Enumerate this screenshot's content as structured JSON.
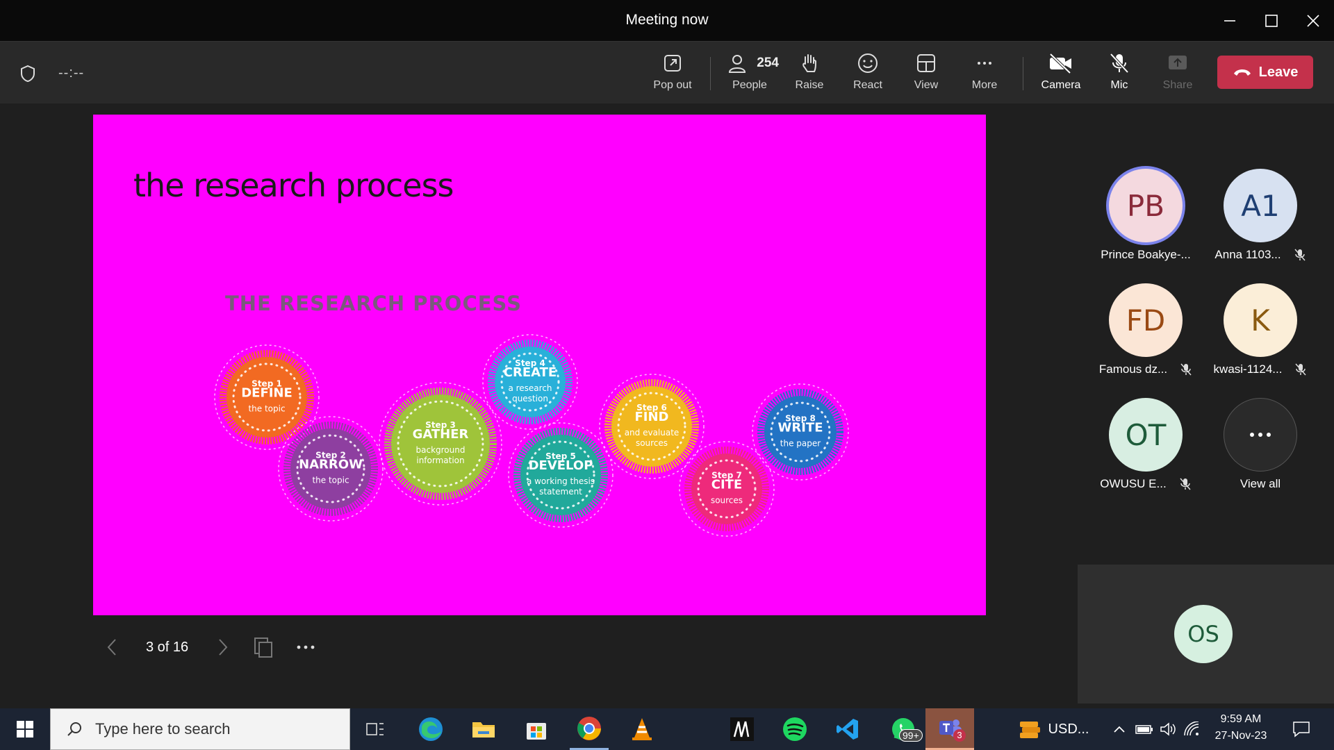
{
  "window": {
    "title": "Meeting now"
  },
  "toolbar": {
    "timer": "--:--",
    "popout_label": "Pop out",
    "people_label": "People",
    "people_count": "254",
    "raise_label": "Raise",
    "react_label": "React",
    "view_label": "View",
    "more_label": "More",
    "camera_label": "Camera",
    "mic_label": "Mic",
    "share_label": "Share",
    "leave_label": "Leave"
  },
  "slide": {
    "title": "the research process",
    "heading": "THE RESEARCH PROCESS",
    "steps": [
      {
        "step": "Step 1",
        "verb": "DEFINE",
        "desc1": "the topic",
        "desc2": "",
        "desc3": "",
        "color": "#f26a22"
      },
      {
        "step": "Step 2",
        "verb": "NARROW",
        "desc1": "the topic",
        "desc2": "",
        "desc3": "",
        "color": "#8e3fa0"
      },
      {
        "step": "Step 3",
        "verb": "GATHER",
        "desc1": "background",
        "desc2": "information",
        "desc3": "",
        "color": "#9fc43a"
      },
      {
        "step": "Step 4",
        "verb": "CREATE",
        "desc1": "a research",
        "desc2": "question",
        "desc3": "",
        "color": "#29b0d9"
      },
      {
        "step": "Step 5",
        "verb": "DEVELOP",
        "desc1": "a working thesis",
        "desc2": "statement",
        "desc3": "",
        "color": "#21a99b"
      },
      {
        "step": "Step 6",
        "verb": "FIND",
        "desc1": "and evaluate",
        "desc2": "sources",
        "desc3": "",
        "color": "#f1b81f"
      },
      {
        "step": "Step 7",
        "verb": "CITE",
        "desc1": "sources",
        "desc2": "",
        "desc3": "",
        "color": "#ee2a7b"
      },
      {
        "step": "Step 8",
        "verb": "WRITE",
        "desc1": "the paper",
        "desc2": "",
        "desc3": "",
        "color": "#2373c4"
      }
    ],
    "page_indicator": "3 of 16"
  },
  "participants": [
    {
      "initials": "PB",
      "name": "Prince Boakye-...",
      "muted": false,
      "bg": "#f4d9df",
      "fg": "#8a2a3a",
      "speaking": true
    },
    {
      "initials": "A1",
      "name": "Anna 1103...",
      "muted": true,
      "bg": "#d7e1f1",
      "fg": "#1f3f73",
      "speaking": false
    },
    {
      "initials": "FD",
      "name": "Famous dz...",
      "muted": true,
      "bg": "#fbe6d6",
      "fg": "#9a4a14",
      "speaking": false
    },
    {
      "initials": "K",
      "name": "kwasi-1124...",
      "muted": true,
      "bg": "#fbeed8",
      "fg": "#8a5a10",
      "speaking": false
    },
    {
      "initials": "OT",
      "name": "OWUSU E...",
      "muted": true,
      "bg": "#d8eee2",
      "fg": "#1e5b3a",
      "speaking": false
    }
  ],
  "view_all_label": "View all",
  "video_tile": {
    "initials": "OS"
  },
  "taskbar": {
    "search_placeholder": "Type here to search",
    "whatsapp_badge": "99+",
    "teams_badge": "3",
    "usd_label": "USD...",
    "time": "9:59 AM",
    "date": "27-Nov-23"
  }
}
